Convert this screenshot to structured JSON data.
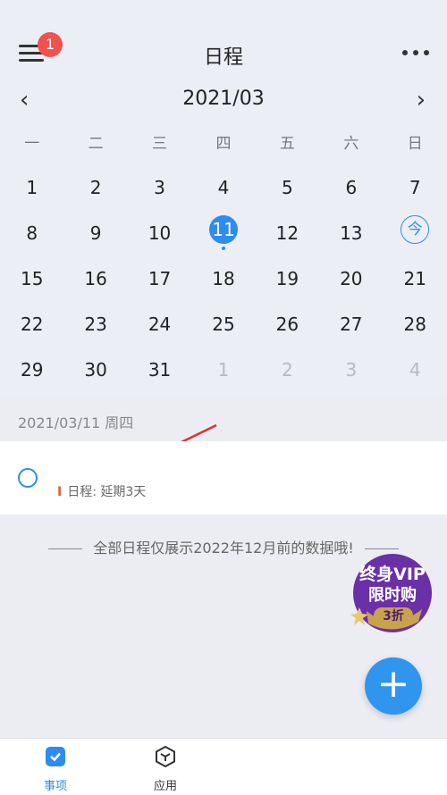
{
  "header": {
    "title": "日程",
    "badge_count": "1",
    "menu_icon": "hamburger-icon",
    "more_icon": "more-dots-icon"
  },
  "calendar": {
    "month_label": "2021/03",
    "prev_icon": "‹",
    "next_icon": "›",
    "weekdays": [
      "一",
      "二",
      "三",
      "四",
      "五",
      "六",
      "日"
    ],
    "weeks": [
      [
        "1",
        "2",
        "3",
        "4",
        "5",
        "6",
        "7"
      ],
      [
        "8",
        "9",
        "10",
        "11",
        "12",
        "13",
        "今"
      ],
      [
        "15",
        "16",
        "17",
        "18",
        "19",
        "20",
        "21"
      ],
      [
        "22",
        "23",
        "24",
        "25",
        "26",
        "27",
        "28"
      ],
      [
        "29",
        "30",
        "31",
        "1",
        "2",
        "3",
        "4"
      ]
    ],
    "selected_day": "11",
    "today_marker": "今"
  },
  "agenda": {
    "date_heading": "2021/03/11 周四",
    "item_delay_marker": "I",
    "item_delay_text": "日程: 延期3天"
  },
  "footnote": "全部日程仅展示2022年12月前的数据哦!",
  "promo": {
    "line1": "终身VIP",
    "line2": "限时购",
    "line3": "3折"
  },
  "fab": {
    "label": "+"
  },
  "tabs": [
    {
      "label": "事项",
      "icon": "checkbox-icon",
      "active": true
    },
    {
      "label": "应用",
      "icon": "hexagon-app-icon",
      "active": false
    }
  ],
  "colors": {
    "accent": "#2d8cf0",
    "badge": "#f2524f",
    "promo": "#6b2fa8"
  }
}
